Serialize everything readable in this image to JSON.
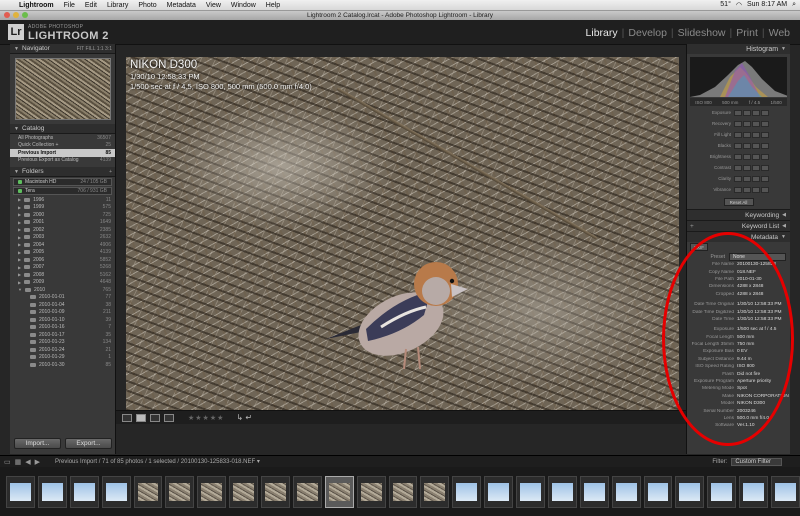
{
  "menubar": {
    "app": "Lightroom",
    "items": [
      "File",
      "Edit",
      "Library",
      "Photo",
      "Metadata",
      "View",
      "Window",
      "Help"
    ],
    "temperature": "51°",
    "clock": "Sun 8:17 AM"
  },
  "window": {
    "title": "Lightroom 2 Catalog.lrcat - Adobe Photoshop Lightroom - Library"
  },
  "identity": {
    "logo_letters": "Lr",
    "brand_sub": "ADOBE PHOTOSHOP",
    "brand_main": "LIGHTROOM 2",
    "modules": [
      "Library",
      "Develop",
      "Slideshow",
      "Print",
      "Web"
    ],
    "active_module": "Library"
  },
  "left": {
    "navigator": {
      "title": "Navigator",
      "zoom_options": "FIT FILL 1:1 3:1"
    },
    "catalog": {
      "title": "Catalog",
      "items": [
        {
          "label": "All Photographs",
          "count": "36507"
        },
        {
          "label": "Quick Collection +",
          "count": "25"
        },
        {
          "label": "Previous Import",
          "count": "85"
        },
        {
          "label": "Previous Export as Catalog",
          "count": "4139"
        }
      ]
    },
    "folders": {
      "title": "Folders",
      "volumes": [
        {
          "label": "Macintosh HD",
          "count": "24 / 105 GB"
        },
        {
          "label": "Tera",
          "count": "706 / 931 GB"
        }
      ],
      "years": [
        {
          "label": "1996",
          "count": "11"
        },
        {
          "label": "1999",
          "count": "575"
        },
        {
          "label": "2000",
          "count": "725"
        },
        {
          "label": "2001",
          "count": "1649"
        },
        {
          "label": "2002",
          "count": "2385"
        },
        {
          "label": "2003",
          "count": "2632"
        },
        {
          "label": "2004",
          "count": "4906"
        },
        {
          "label": "2005",
          "count": "4139"
        },
        {
          "label": "2006",
          "count": "5852"
        },
        {
          "label": "2007",
          "count": "5268"
        },
        {
          "label": "2008",
          "count": "5162"
        },
        {
          "label": "2009",
          "count": "4648"
        },
        {
          "label": "2010",
          "count": "765"
        }
      ],
      "subfolders": [
        {
          "label": "2010-01-01",
          "count": "77"
        },
        {
          "label": "2010-01-04",
          "count": "38"
        },
        {
          "label": "2010-01-09",
          "count": "211"
        },
        {
          "label": "2010-01-10",
          "count": "39"
        },
        {
          "label": "2010-01-16",
          "count": "7"
        },
        {
          "label": "2010-01-17",
          "count": "35"
        },
        {
          "label": "2010-01-23",
          "count": "134"
        },
        {
          "label": "2010-01-24",
          "count": "21"
        },
        {
          "label": "2010-01-29",
          "count": "1"
        },
        {
          "label": "2010-01-30",
          "count": "85"
        }
      ]
    },
    "import_label": "Import...",
    "export_label": "Export..."
  },
  "photo": {
    "model": "NIKON D300",
    "date": "1/30/10 12:58:33 PM",
    "exposure": "1/500 sec at f / 4.5, ISO 800, 500 mm (500.0 mm f/4.0)"
  },
  "toolbar": {
    "stars": "★★★★★",
    "arrows": "↳ ↵"
  },
  "right": {
    "histogram": {
      "title": "Histogram",
      "info": [
        "ISO 800",
        "500 mm",
        "f / 4.5",
        "1/500"
      ]
    },
    "develop_rows": [
      "Exposure",
      "Recovery",
      "Fill Light",
      "Blacks",
      "Brightness",
      "Contrast",
      "Clarity",
      "Vibrance"
    ],
    "reset_label": "Reset All",
    "keywording_title": "Keywording",
    "keyword_list_title": "Keyword List",
    "metadata_title": "Metadata",
    "exif_select": "EXIF",
    "preset_label": "Preset",
    "preset_value": "None",
    "metadata": [
      {
        "label": "File Name",
        "value": "20100130-125833"
      },
      {
        "label": "Copy Name",
        "value": "018.NEF"
      },
      {
        "label": "File Path",
        "value": "2010-01-30"
      },
      {
        "label": "Dimensions",
        "value": "4288 x 2848"
      },
      {
        "label": "Cropped",
        "value": "4288 x 2848"
      },
      {
        "label": "",
        "value": ""
      },
      {
        "label": "Date Time Original",
        "value": "1/30/10 12:58:33 PM"
      },
      {
        "label": "Date Time Digitized",
        "value": "1/30/10 12:58:33 PM"
      },
      {
        "label": "Date Time",
        "value": "1/30/10 12:58:33 PM"
      },
      {
        "label": "",
        "value": ""
      },
      {
        "label": "Exposure",
        "value": "1/500 sec at f / 4.5"
      },
      {
        "label": "Focal Length",
        "value": "500 mm"
      },
      {
        "label": "Focal Length 35mm",
        "value": "750 mm"
      },
      {
        "label": "Exposure Bias",
        "value": "0 EV"
      },
      {
        "label": "Subject Distance",
        "value": "9.44 m"
      },
      {
        "label": "ISO Speed Rating",
        "value": "ISO 800"
      },
      {
        "label": "Flash",
        "value": "Did not fire"
      },
      {
        "label": "Exposure Program",
        "value": "Aperture priority"
      },
      {
        "label": "Metering Mode",
        "value": "Spot"
      },
      {
        "label": "Make",
        "value": "NIKON CORPORATION"
      },
      {
        "label": "Model",
        "value": "NIKON D300"
      },
      {
        "label": "Serial Number",
        "value": "2003246"
      },
      {
        "label": "Lens",
        "value": "500.0 mm f/4.0"
      },
      {
        "label": "Software",
        "value": "Ver.1.10"
      }
    ]
  },
  "filmstrip": {
    "info": "Previous Import / 71 of 85 photos / 1 selected / 20100130-125833-018.NEF ▾",
    "filter_label": "Filter:",
    "filter_value": "Custom Filter"
  },
  "colors": {
    "annotation": "#e60000",
    "panel": "#393939",
    "background": "#262626"
  }
}
